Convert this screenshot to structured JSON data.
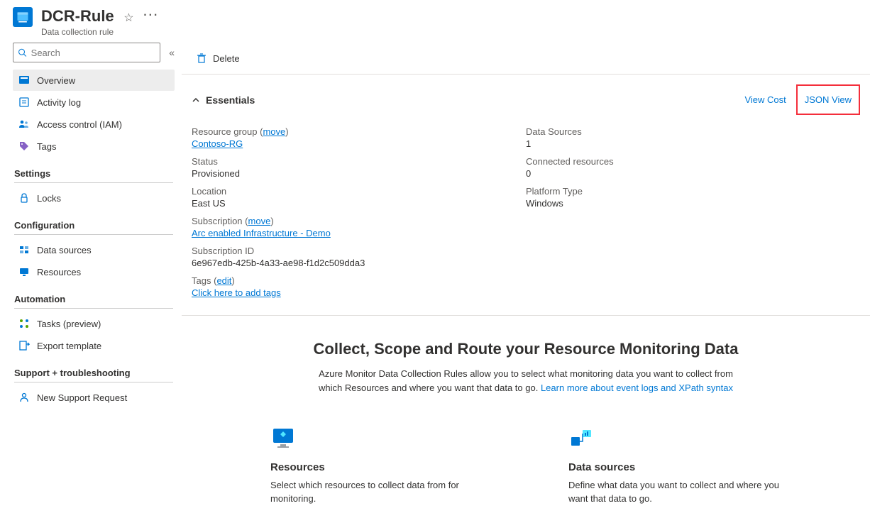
{
  "header": {
    "title": "DCR-Rule",
    "subtitle": "Data collection rule"
  },
  "search": {
    "placeholder": "Search"
  },
  "sidebar": {
    "top": [
      {
        "label": "Overview"
      },
      {
        "label": "Activity log"
      },
      {
        "label": "Access control (IAM)"
      },
      {
        "label": "Tags"
      }
    ],
    "groups": [
      {
        "title": "Settings",
        "items": [
          {
            "label": "Locks"
          }
        ]
      },
      {
        "title": "Configuration",
        "items": [
          {
            "label": "Data sources"
          },
          {
            "label": "Resources"
          }
        ]
      },
      {
        "title": "Automation",
        "items": [
          {
            "label": "Tasks (preview)"
          },
          {
            "label": "Export template"
          }
        ]
      },
      {
        "title": "Support + troubleshooting",
        "items": [
          {
            "label": "New Support Request"
          }
        ]
      }
    ]
  },
  "toolbar": {
    "delete": "Delete"
  },
  "essentials": {
    "toggle_label": "Essentials",
    "view_cost": "View Cost",
    "json_view": "JSON View",
    "left": {
      "resource_group_label": "Resource group",
      "resource_group_move": "move",
      "resource_group_value": "Contoso-RG",
      "status_label": "Status",
      "status_value": "Provisioned",
      "location_label": "Location",
      "location_value": "East US",
      "subscription_label": "Subscription",
      "subscription_move": "move",
      "subscription_value": "Arc enabled Infrastructure - Demo",
      "subscription_id_label": "Subscription ID",
      "subscription_id_value": "6e967edb-425b-4a33-ae98-f1d2c509dda3",
      "tags_label": "Tags",
      "tags_edit": "edit",
      "tags_value": "Click here to add tags"
    },
    "right": {
      "data_sources_label": "Data Sources",
      "data_sources_value": "1",
      "connected_resources_label": "Connected resources",
      "connected_resources_value": "0",
      "platform_type_label": "Platform Type",
      "platform_type_value": "Windows"
    }
  },
  "hero": {
    "title": "Collect, Scope and Route your Resource Monitoring Data",
    "desc_part1": "Azure Monitor Data Collection Rules allow you to select what monitoring data you want to collect from which Resources and where you want that data to go. ",
    "learn_more": "Learn more about event logs and XPath syntax"
  },
  "cards": {
    "resources": {
      "title": "Resources",
      "desc": "Select which resources to collect data from for monitoring."
    },
    "data_sources": {
      "title": "Data sources",
      "desc": "Define what data you want to collect and where you want that data to go."
    }
  }
}
